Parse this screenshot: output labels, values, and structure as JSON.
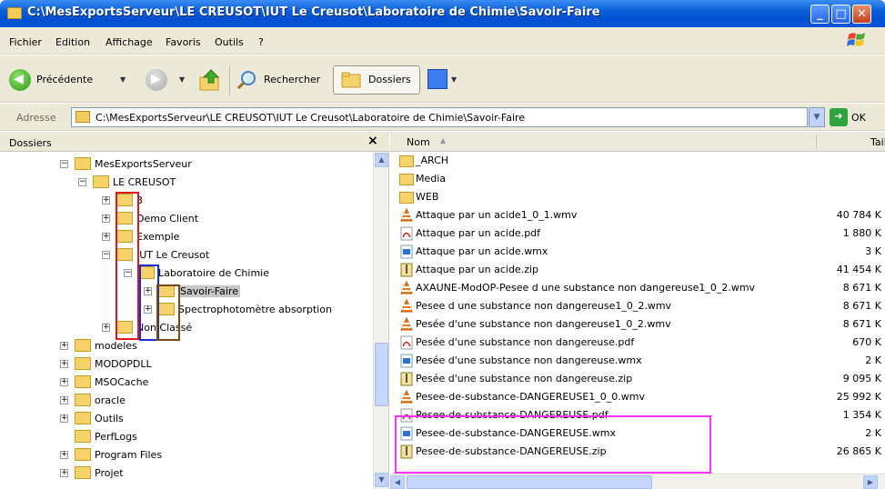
{
  "window": {
    "title": "C:\\MesExportsServeur\\LE CREUSOT\\IUT Le Creusot\\Laboratoire de Chimie\\Savoir-Faire"
  },
  "menu": [
    "Fichier",
    "Edition",
    "Affichage",
    "Favoris",
    "Outils",
    "?"
  ],
  "toolbar": {
    "back_label": "Précédente",
    "search_label": "Rechercher",
    "folders_label": "Dossiers"
  },
  "address": {
    "label": "Adresse",
    "value": "C:\\MesExportsServeur\\LE CREUSOT\\IUT Le Creusot\\Laboratoire de Chimie\\Savoir-Faire",
    "go_label": "OK"
  },
  "folder_pane": {
    "title": "Dossiers",
    "close": "×",
    "tree": [
      {
        "label": "MesExportsServeur",
        "level": 0,
        "exp": "−"
      },
      {
        "label": "LE CREUSOT",
        "level": 1,
        "exp": "−"
      },
      {
        "label": "3",
        "level": 2,
        "exp": "+"
      },
      {
        "label": "Demo Client",
        "level": 2,
        "exp": "+"
      },
      {
        "label": "Exemple",
        "level": 2,
        "exp": "+"
      },
      {
        "label": "IUT Le Creusot",
        "level": 2,
        "exp": "−"
      },
      {
        "label": "Laboratoire de Chimie",
        "level": 3,
        "exp": "−"
      },
      {
        "label": "Savoir-Faire",
        "level": 4,
        "exp": "+",
        "selected": true
      },
      {
        "label": "Spectrophotomètre absorption",
        "level": 4,
        "exp": "+"
      },
      {
        "label": "Non Classé",
        "level": 2,
        "exp": "+"
      },
      {
        "label": "modeles",
        "level": -1,
        "exp": "+"
      },
      {
        "label": "MODOPDLL",
        "level": -1,
        "exp": "+"
      },
      {
        "label": "MSOCache",
        "level": -1,
        "exp": "+"
      },
      {
        "label": "oracle",
        "level": -1,
        "exp": "+"
      },
      {
        "label": "Outils",
        "level": -1,
        "exp": "+"
      },
      {
        "label": "PerfLogs",
        "level": -1,
        "exp": ""
      },
      {
        "label": "Program Files",
        "level": -1,
        "exp": "+"
      },
      {
        "label": "Projet",
        "level": -1,
        "exp": "+"
      }
    ]
  },
  "file_pane": {
    "col_name": "Nom",
    "col_size": "Taille",
    "files": [
      {
        "name": "_ARCH",
        "size": "",
        "type": "folder"
      },
      {
        "name": "Media",
        "size": "",
        "type": "folder"
      },
      {
        "name": "WEB",
        "size": "",
        "type": "folder"
      },
      {
        "name": "Attaque par un acide1_0_1.wmv",
        "size": "40 784 K",
        "type": "vlc"
      },
      {
        "name": "Attaque par un acide.pdf",
        "size": "1 880 K",
        "type": "pdf"
      },
      {
        "name": "Attaque par un acide.wmx",
        "size": "3 K",
        "type": "wmx"
      },
      {
        "name": "Attaque par un acide.zip",
        "size": "41 454 K",
        "type": "zip"
      },
      {
        "name": "AXAUNE-ModOP-Pesee d une substance non dangereuse1_0_2.wmv",
        "size": "8 671 K",
        "type": "vlc"
      },
      {
        "name": "Pesee d une substance non dangereuse1_0_2.wmv",
        "size": "8 671 K",
        "type": "vlc"
      },
      {
        "name": "Pesée d'une substance non dangereuse1_0_2.wmv",
        "size": "8 671 K",
        "type": "vlc"
      },
      {
        "name": "Pesée d'une substance non dangereuse.pdf",
        "size": "670 K",
        "type": "pdf"
      },
      {
        "name": "Pesée d'une substance non dangereuse.wmx",
        "size": "2 K",
        "type": "wmx"
      },
      {
        "name": "Pesée d'une substance non dangereuse.zip",
        "size": "9 095 K",
        "type": "zip"
      },
      {
        "name": "Pesee-de-substance-DANGEREUSE1_0_0.wmv",
        "size": "25 992 K",
        "type": "vlc"
      },
      {
        "name": "Pesee-de-substance-DANGEREUSE.pdf",
        "size": "1 354 K",
        "type": "pdf"
      },
      {
        "name": "Pesee-de-substance-DANGEREUSE.wmx",
        "size": "2 K",
        "type": "wmx"
      },
      {
        "name": "Pesee-de-substance-DANGEREUSE.zip",
        "size": "26 865 K",
        "type": "zip"
      }
    ]
  },
  "colors": {
    "title_bar": "#0a5fd8",
    "highlight_red": "#e0161b",
    "highlight_blue": "#1a2fd0",
    "highlight_brown": "#7a4a1a",
    "highlight_magenta": "#ff33ff"
  }
}
